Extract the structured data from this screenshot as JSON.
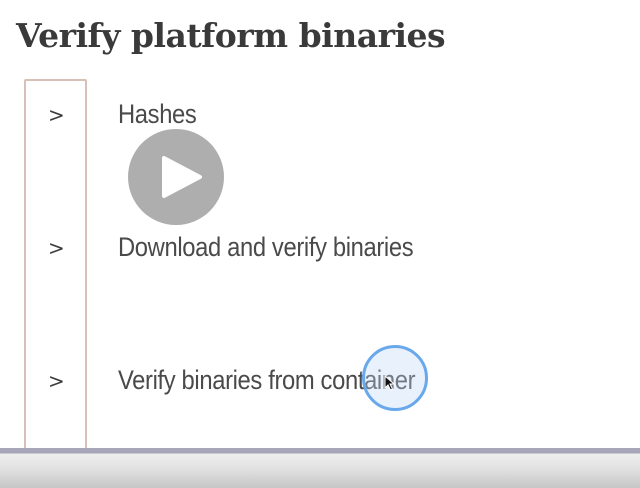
{
  "page": {
    "title": "Verify platform binaries"
  },
  "sections": [
    {
      "label": "Hashes",
      "chevron": ">",
      "expanded": false
    },
    {
      "label": "Download and verify binaries",
      "chevron": ">",
      "expanded": false
    },
    {
      "label": "Verify binaries from container",
      "chevron": ">",
      "expanded": false
    }
  ],
  "overlay": {
    "play_icon": "play-icon",
    "cursor_icon": "mouse-pointer-icon",
    "click_highlight_color": "#6aa8ec"
  },
  "colors": {
    "title": "#3a3a3a",
    "label": "#4a4a4a",
    "rail_border": "#d8c0b7",
    "play_overlay": "#a0a0a0"
  }
}
